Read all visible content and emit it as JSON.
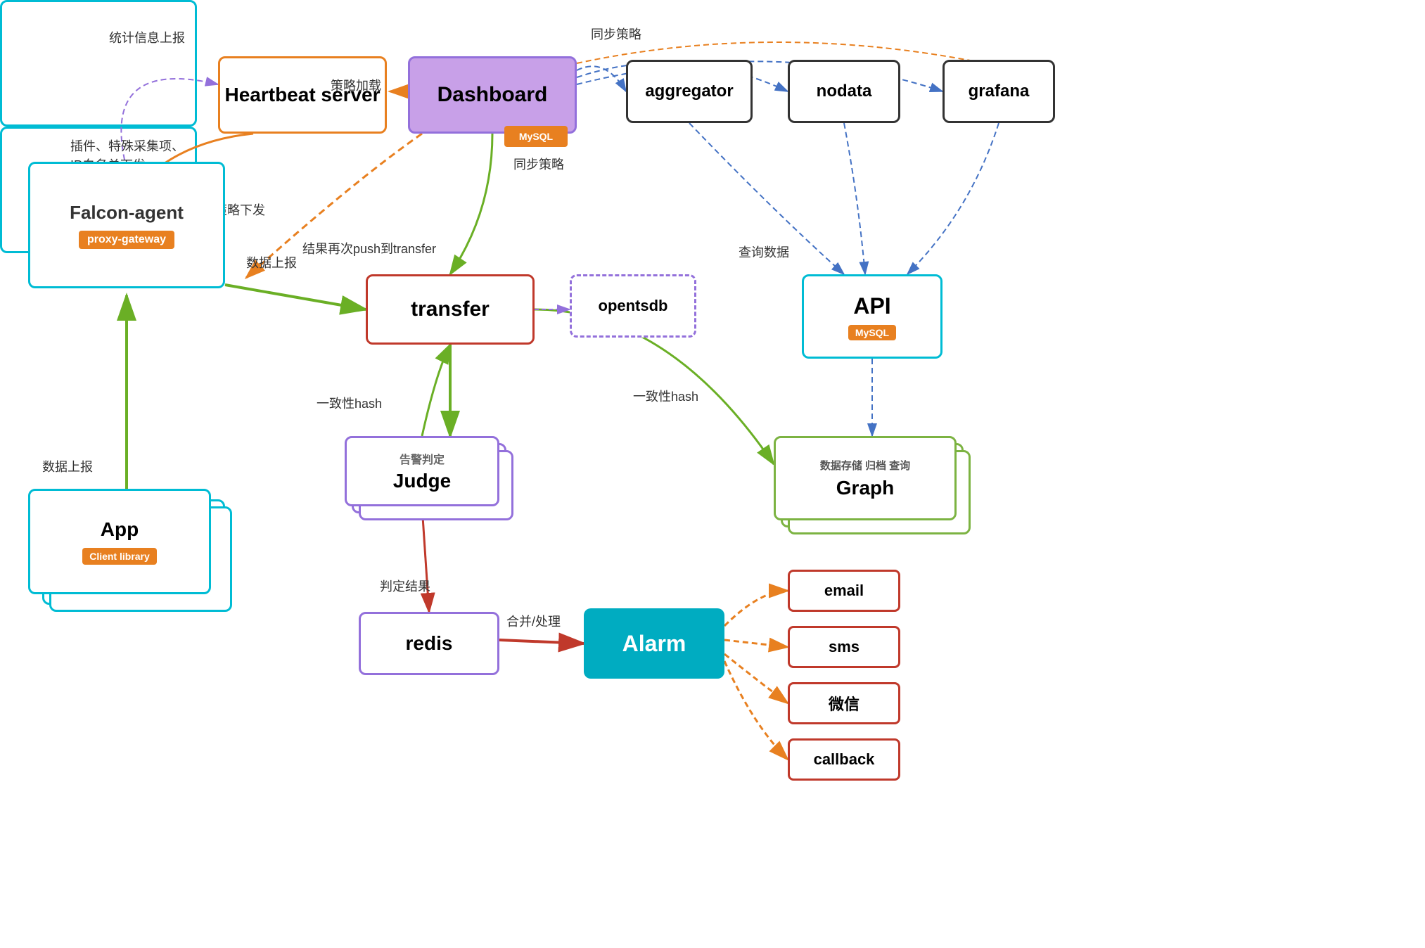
{
  "nodes": {
    "heartbeat": "Heartbeat server",
    "dashboard": "Dashboard",
    "mysql_dashboard": "MySQL",
    "aggregator": "aggregator",
    "nodata": "nodata",
    "grafana": "grafana",
    "falcon_agent": "Falcon-agent",
    "proxy_gateway": "proxy-gateway",
    "transfer": "transfer",
    "opentsdb": "opentsdb",
    "judge": "Judge",
    "redis": "redis",
    "alarm": "Alarm",
    "email": "email",
    "sms": "sms",
    "weixin": "微信",
    "callback": "callback",
    "api": "API",
    "mysql_api": "MySQL",
    "graph": "Graph",
    "app": "App",
    "client_library": "Client library"
  },
  "labels": {
    "tongji_shangbao": "统计信息上报",
    "celue_jiazai": "策略加载",
    "celue_xiafa_plugin": "插件、特殊采集项、",
    "celue_xiafa_ip": "IP白名单下发",
    "celue_xiafa": "策略下发",
    "shuju_shangbao1": "数据上报",
    "shuju_shangbao2": "数据上报",
    "jieguo_push": "结果再次push到transfer",
    "yizhi_hash1": "一致性hash",
    "yizhi_hash2": "一致性hash",
    "tongbu_celue1": "同步策略",
    "tongbu_celue2": "同步策略",
    "chaxun_shuju": "查询数据",
    "gaojing_panding": "告警判定",
    "panding_jieguo": "判定结果",
    "hebing_chuli": "合并/处理",
    "shuju_cunchu": "数据存储 归档 查询"
  }
}
